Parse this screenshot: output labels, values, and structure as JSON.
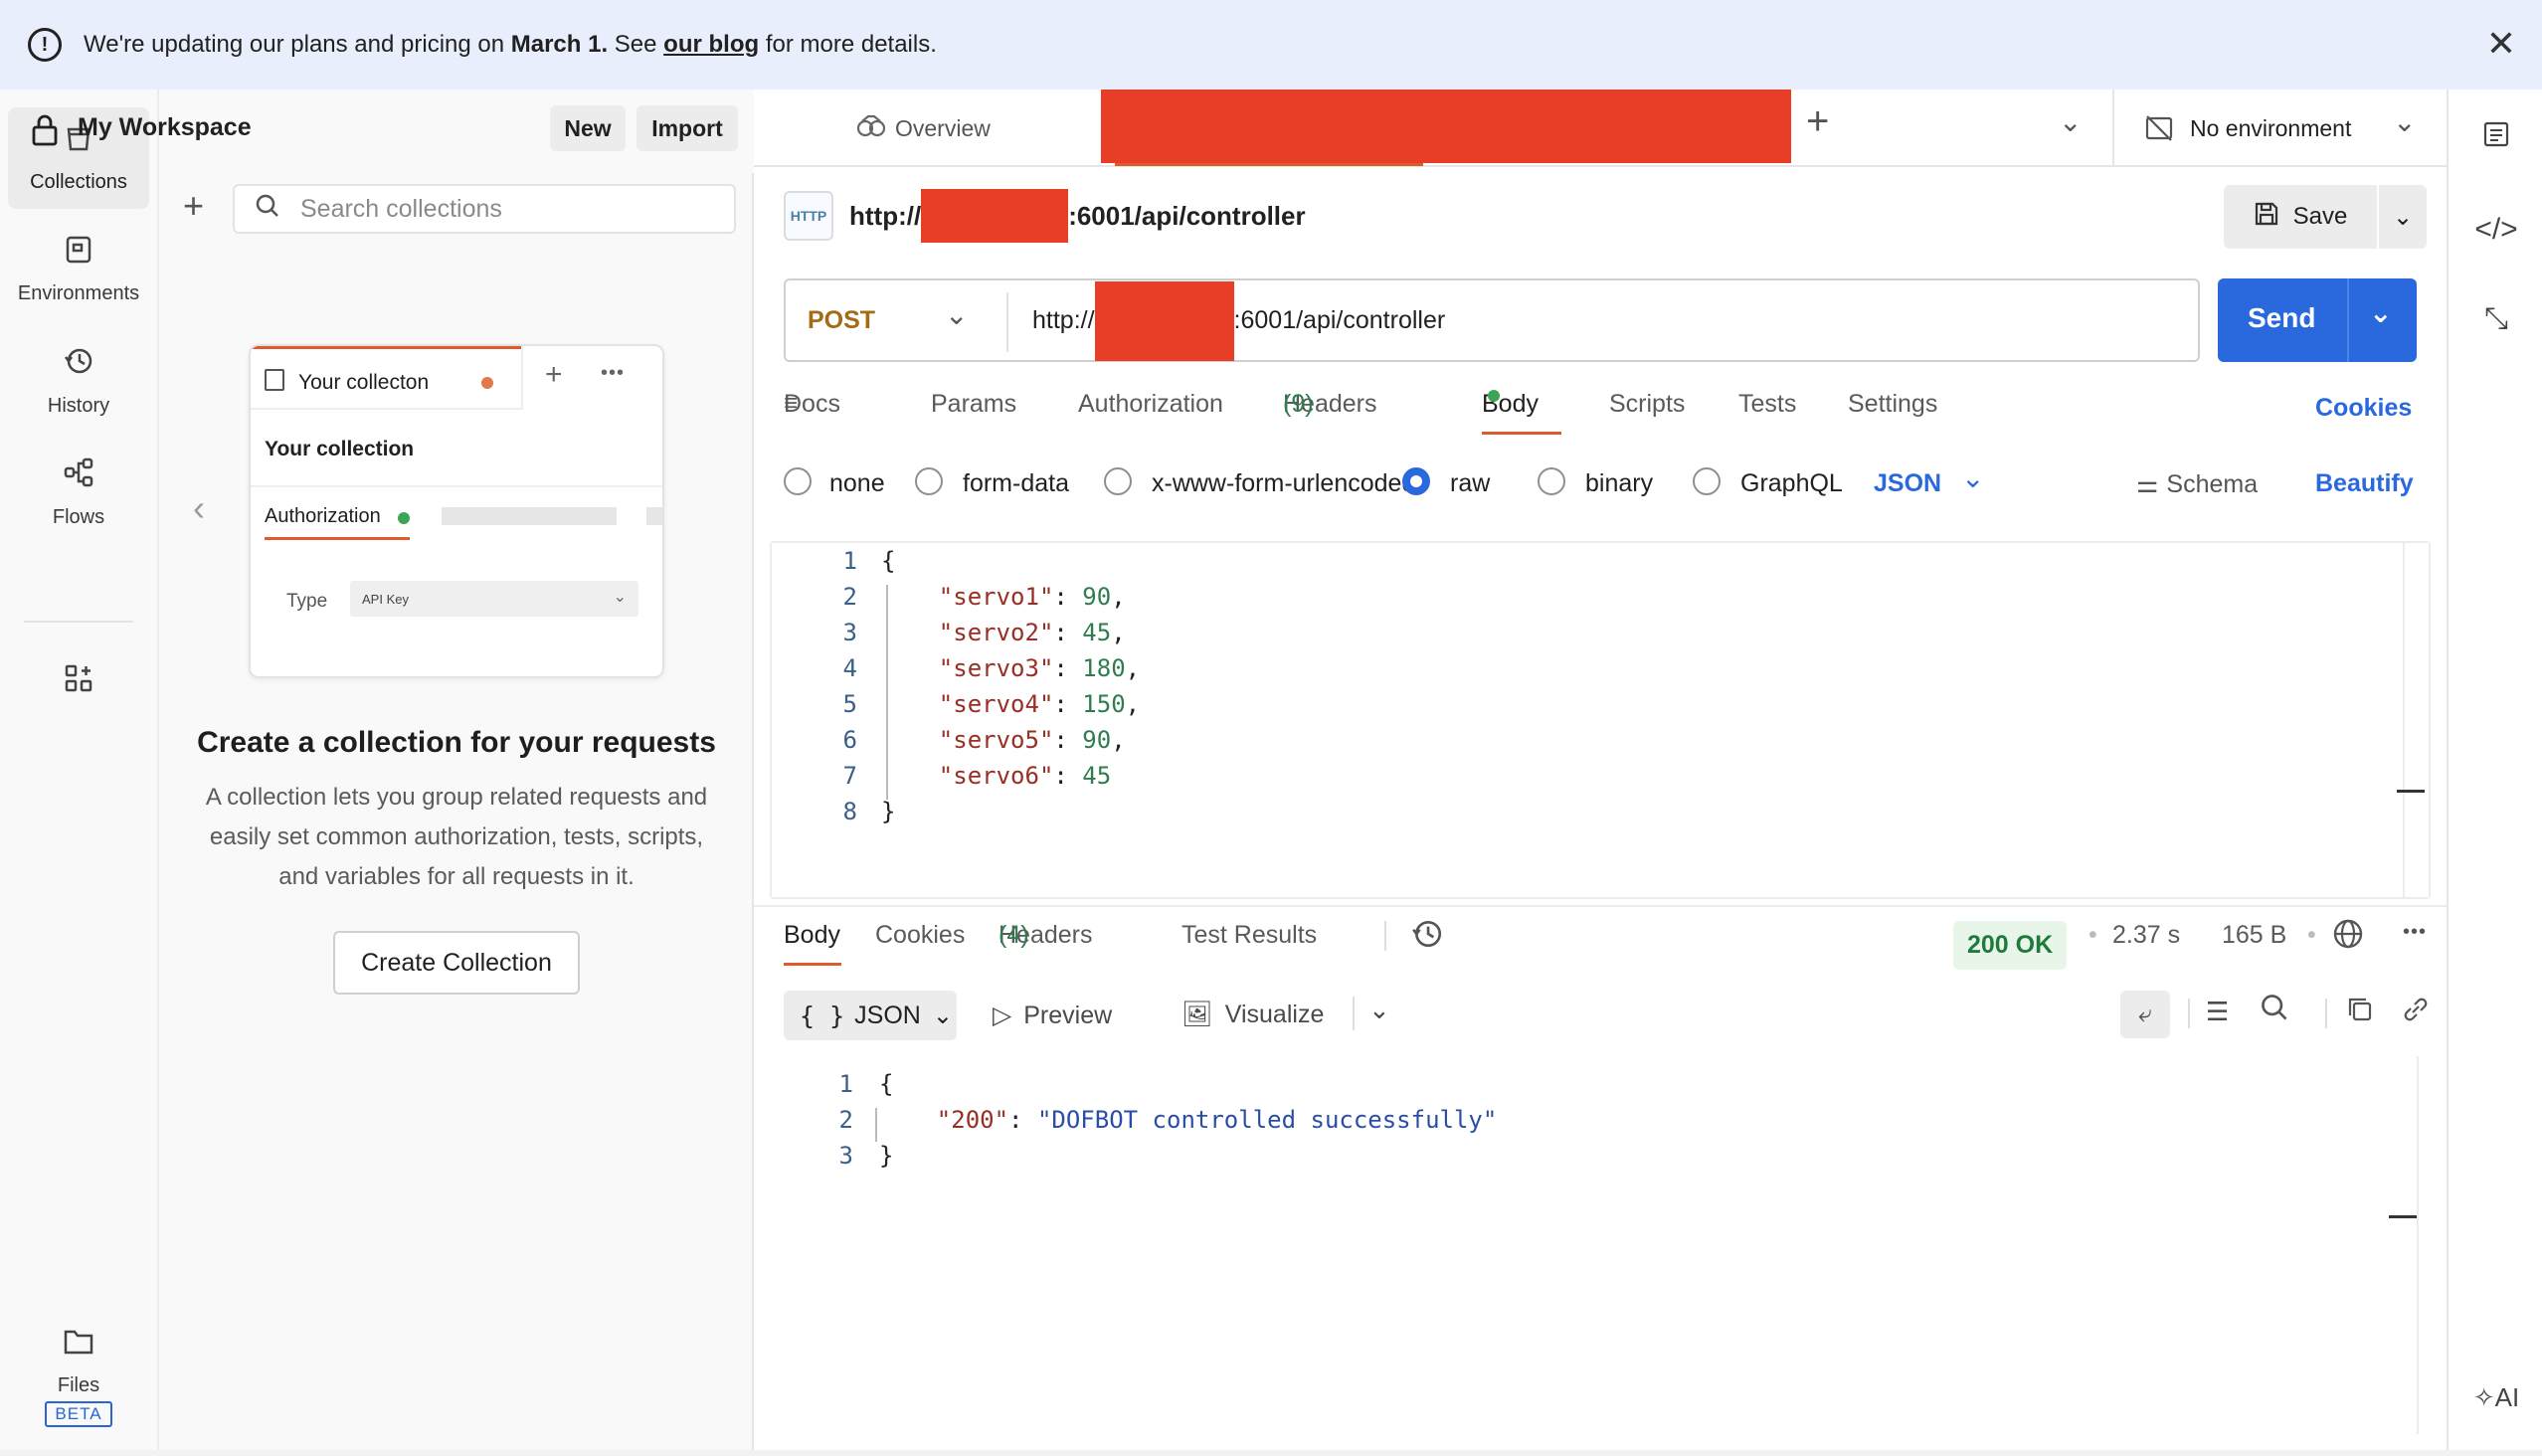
{
  "banner": {
    "text_before": "We're updating our plans and pricing on ",
    "date": "March 1.",
    "text_mid": " See ",
    "link": "our blog",
    "text_after": " for more details."
  },
  "rail": {
    "items": [
      {
        "label": "Collections",
        "icon": "collections-icon"
      },
      {
        "label": "Environments",
        "icon": "environments-icon"
      },
      {
        "label": "History",
        "icon": "history-icon"
      },
      {
        "label": "Flows",
        "icon": "flows-icon"
      }
    ],
    "files_label": "Files",
    "beta_label": "BETA"
  },
  "sidebar": {
    "workspace_title": "My Workspace",
    "new_label": "New",
    "import_label": "Import",
    "search_placeholder": "Search collections",
    "preview": {
      "tab_label": "Your collecton",
      "heading": "Your collection",
      "auth_tab": "Authorization",
      "type_label": "Type",
      "type_value": "API Key"
    },
    "empty_title": "Create a collection for your requests",
    "empty_desc": "A collection lets you group related requests and easily set common authorization, tests, scripts, and variables for all requests in it.",
    "create_button": "Create Collection"
  },
  "tabs": {
    "overview": "Overview",
    "environment": "No environment"
  },
  "request": {
    "title_prefix": "http://",
    "title_suffix": ":6001/api/controller",
    "save_label": "Save",
    "method": "POST",
    "url_prefix": "http://",
    "url_suffix": ":6001/api/controller",
    "send_label": "Send",
    "tabs": {
      "docs": "Docs",
      "params": "Params",
      "authorization": "Authorization",
      "headers": "Headers",
      "headers_count": "(9)",
      "body": "Body",
      "scripts": "Scripts",
      "tests": "Tests",
      "settings": "Settings",
      "cookies": "Cookies"
    },
    "body_modes": {
      "none": "none",
      "form_data": "form-data",
      "urlencoded": "x-www-form-urlencoded",
      "raw": "raw",
      "binary": "binary",
      "graphql": "GraphQL",
      "format": "JSON",
      "schema": "Schema",
      "beautify": "Beautify"
    },
    "body_lines": [
      {
        "n": "1",
        "text": "{"
      },
      {
        "n": "2",
        "key": "\"servo1\"",
        "val": "90",
        "comma": ","
      },
      {
        "n": "3",
        "key": "\"servo2\"",
        "val": "45",
        "comma": ","
      },
      {
        "n": "4",
        "key": "\"servo3\"",
        "val": "180",
        "comma": ","
      },
      {
        "n": "5",
        "key": "\"servo4\"",
        "val": "150",
        "comma": ","
      },
      {
        "n": "6",
        "key": "\"servo5\"",
        "val": "90",
        "comma": ","
      },
      {
        "n": "7",
        "key": "\"servo6\"",
        "val": "45",
        "comma": ""
      },
      {
        "n": "8",
        "text": "}"
      }
    ]
  },
  "response": {
    "tabs": {
      "body": "Body",
      "cookies": "Cookies",
      "headers": "Headers",
      "headers_count": "(4)",
      "test_results": "Test Results"
    },
    "status": "200 OK",
    "time": "2.37 s",
    "size": "165 B",
    "format": "JSON",
    "preview": "Preview",
    "visualize": "Visualize",
    "lines": [
      {
        "n": "1",
        "text": "{"
      },
      {
        "n": "2",
        "key": "\"200\"",
        "val": "\"DOFBOT controlled successfully\""
      },
      {
        "n": "3",
        "text": "}"
      }
    ]
  },
  "colors": {
    "accent": "#2a68de",
    "redaction": "#e83e28",
    "method": "#a46a16",
    "status_ok": "#217a3c"
  }
}
